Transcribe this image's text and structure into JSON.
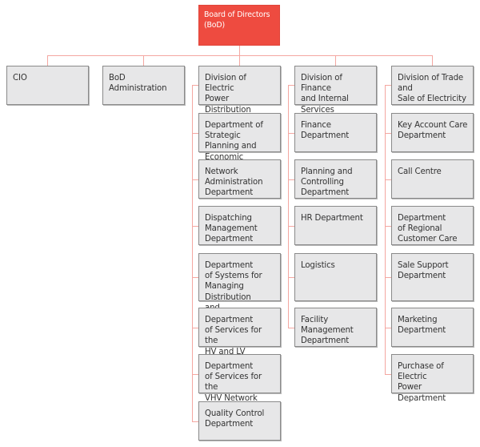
{
  "colors": {
    "root_fill": "#ee4b40",
    "box_fill": "#e7e7e8",
    "connector": "#f4a7a1",
    "text": "#333333"
  },
  "root": {
    "label": "Board of Directors\n(BoD)"
  },
  "columns": [
    {
      "label": "CIO",
      "children": []
    },
    {
      "label": "BoD\nAdministration",
      "children": []
    },
    {
      "label": "Division of Electric\nPower Distribution",
      "children": [
        "Department of\nStrategic Planning and\nEconomic Distribution",
        "Network\nAdministration\nDepartment",
        "Dispatching\nManagement\nDepartment",
        "Department\nof Systems for\nManaging Distribution\nand Measurement",
        "Department\nof Services for the\nHV and LV Network",
        "Department\nof Services for the\nVHV Network",
        "Quality Control\nDepartment"
      ]
    },
    {
      "label": "Division of Finance\nand Internal Services",
      "children": [
        "Finance\nDepartment",
        "Planning and\nControlling\nDepartment",
        "HR Department",
        "Logistics",
        "Facility\nManagement\nDepartment"
      ]
    },
    {
      "label": "Division of Trade and\nSale of Electricity",
      "children": [
        "Key Account Care\nDepartment",
        "Call Centre",
        "Department\nof Regional\nCustomer Care",
        "Sale Support\nDepartment",
        "Marketing\nDepartment",
        "Purchase of Electric\nPower Department"
      ]
    }
  ]
}
